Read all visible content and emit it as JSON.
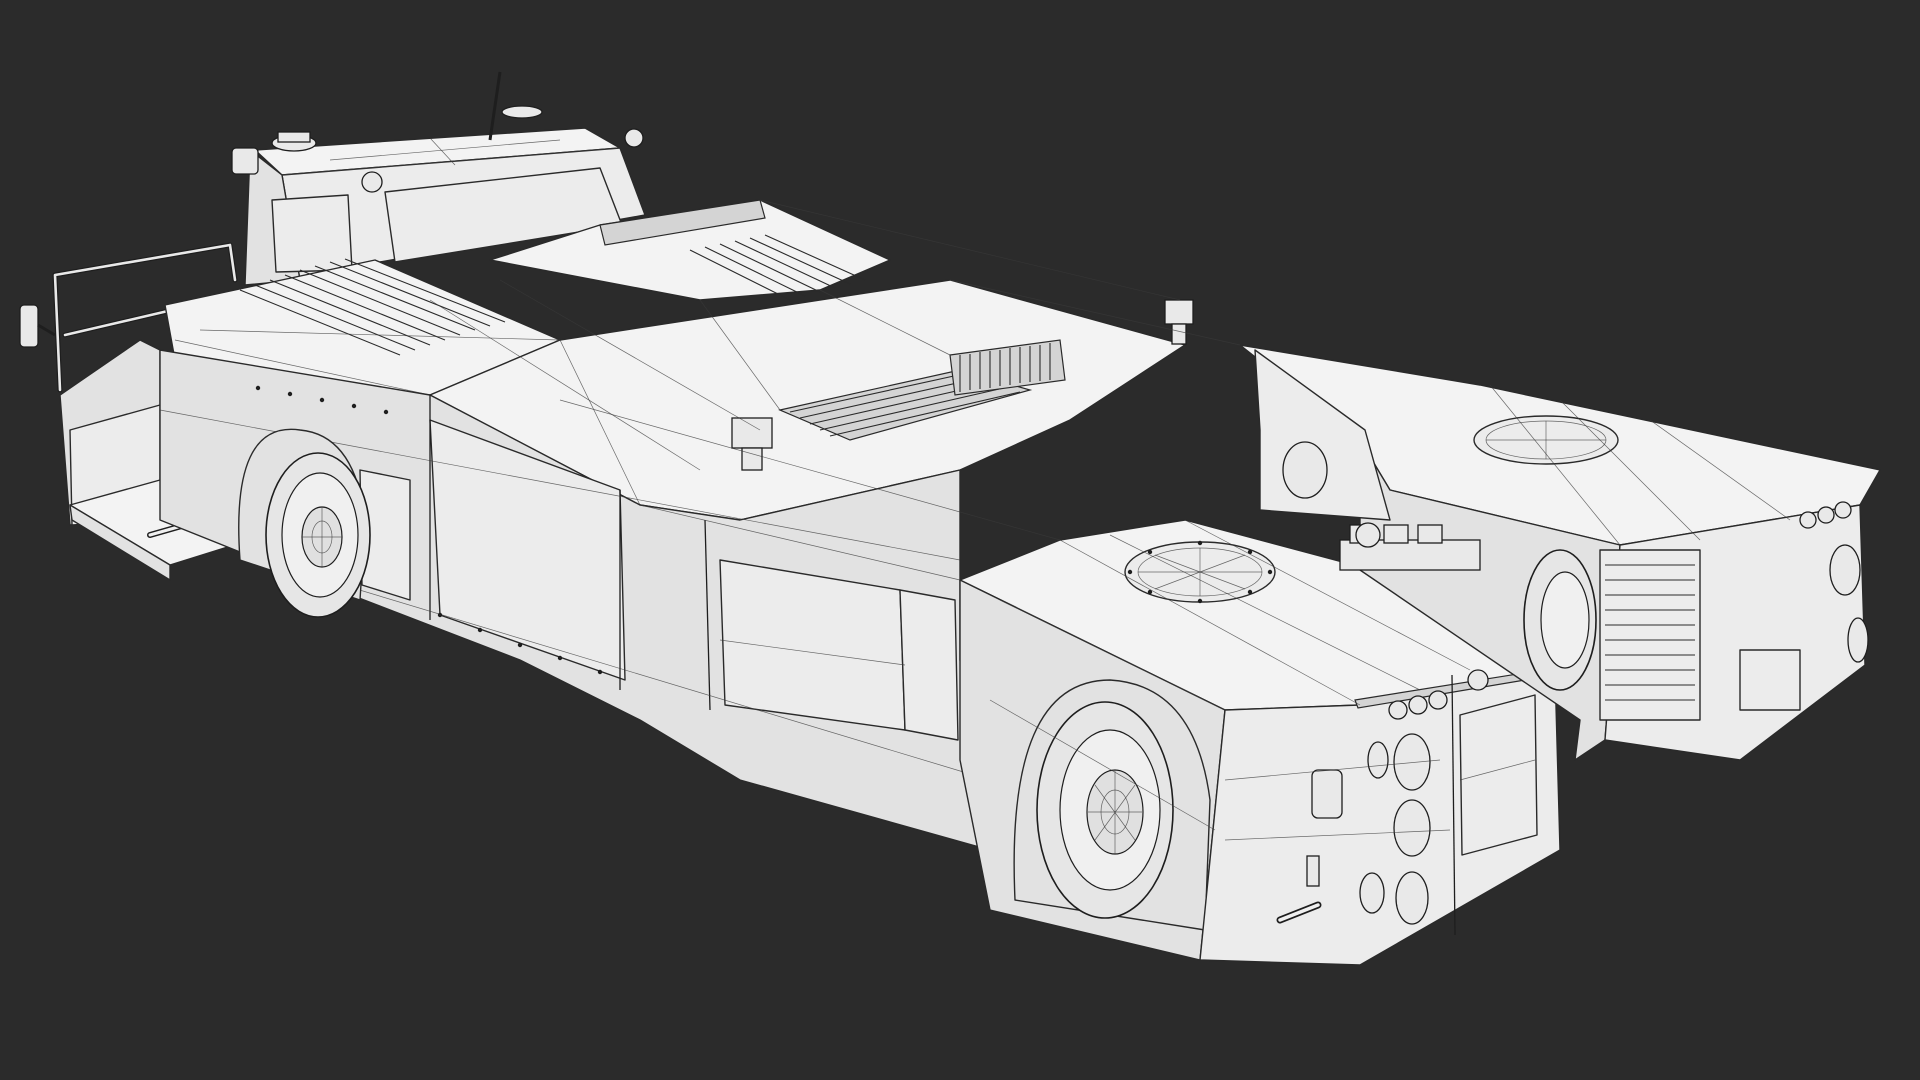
{
  "scene": {
    "background": "#2b2b2b",
    "model_fill": "#ececec",
    "wire_color": "#2a2a2a",
    "render_mode": "wireframe-on-shaded"
  }
}
